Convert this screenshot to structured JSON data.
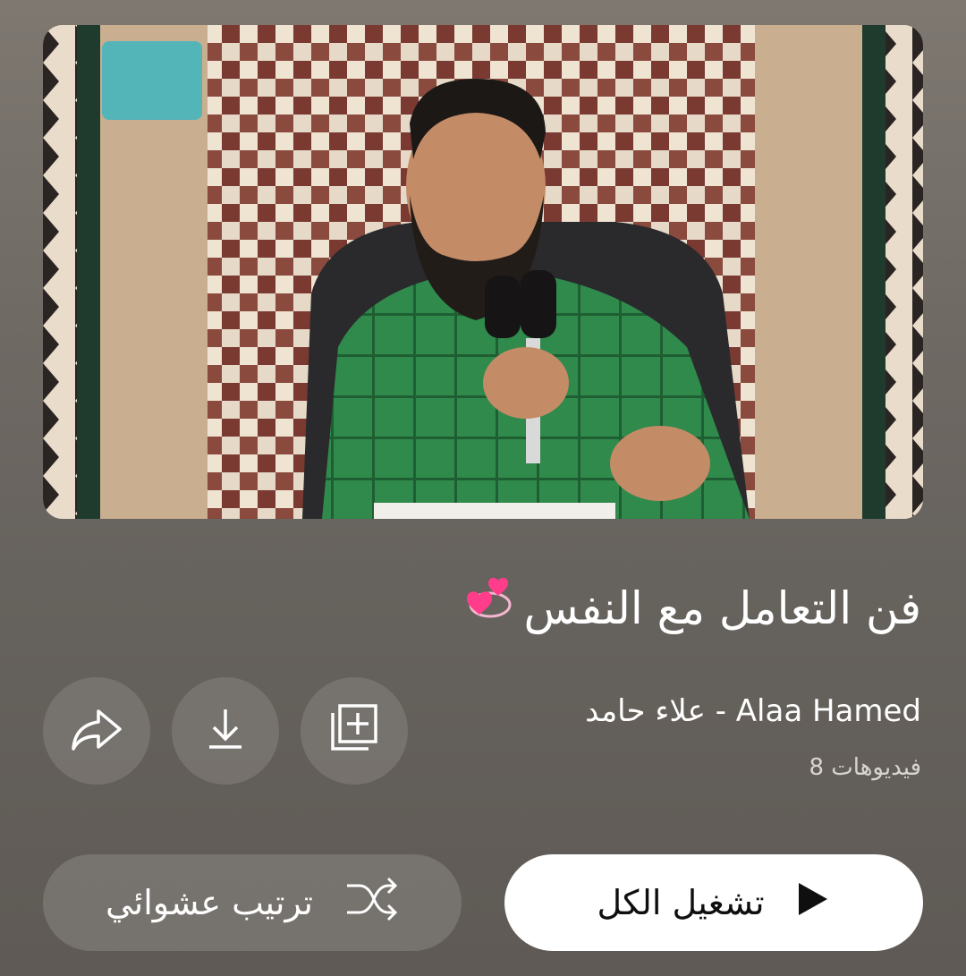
{
  "playlist": {
    "title": "فن التعامل مع النفس",
    "title_emoji_icon": "revolving-hearts-icon",
    "channel": "علاء حامد - Alaa Hamed",
    "video_count": "8 فيديوهات"
  },
  "actions": {
    "share_icon": "share-icon",
    "download_icon": "download-icon",
    "save_icon": "add-to-library-icon"
  },
  "buttons": {
    "play_all_label": "تشغيل الكل",
    "shuffle_label": "ترتيب عشوائي"
  },
  "colors": {
    "background": "#6f6964",
    "play_button": "#ffffff",
    "shuffle_button": "#8a8580",
    "heart_pink": "#ff3d8b"
  }
}
